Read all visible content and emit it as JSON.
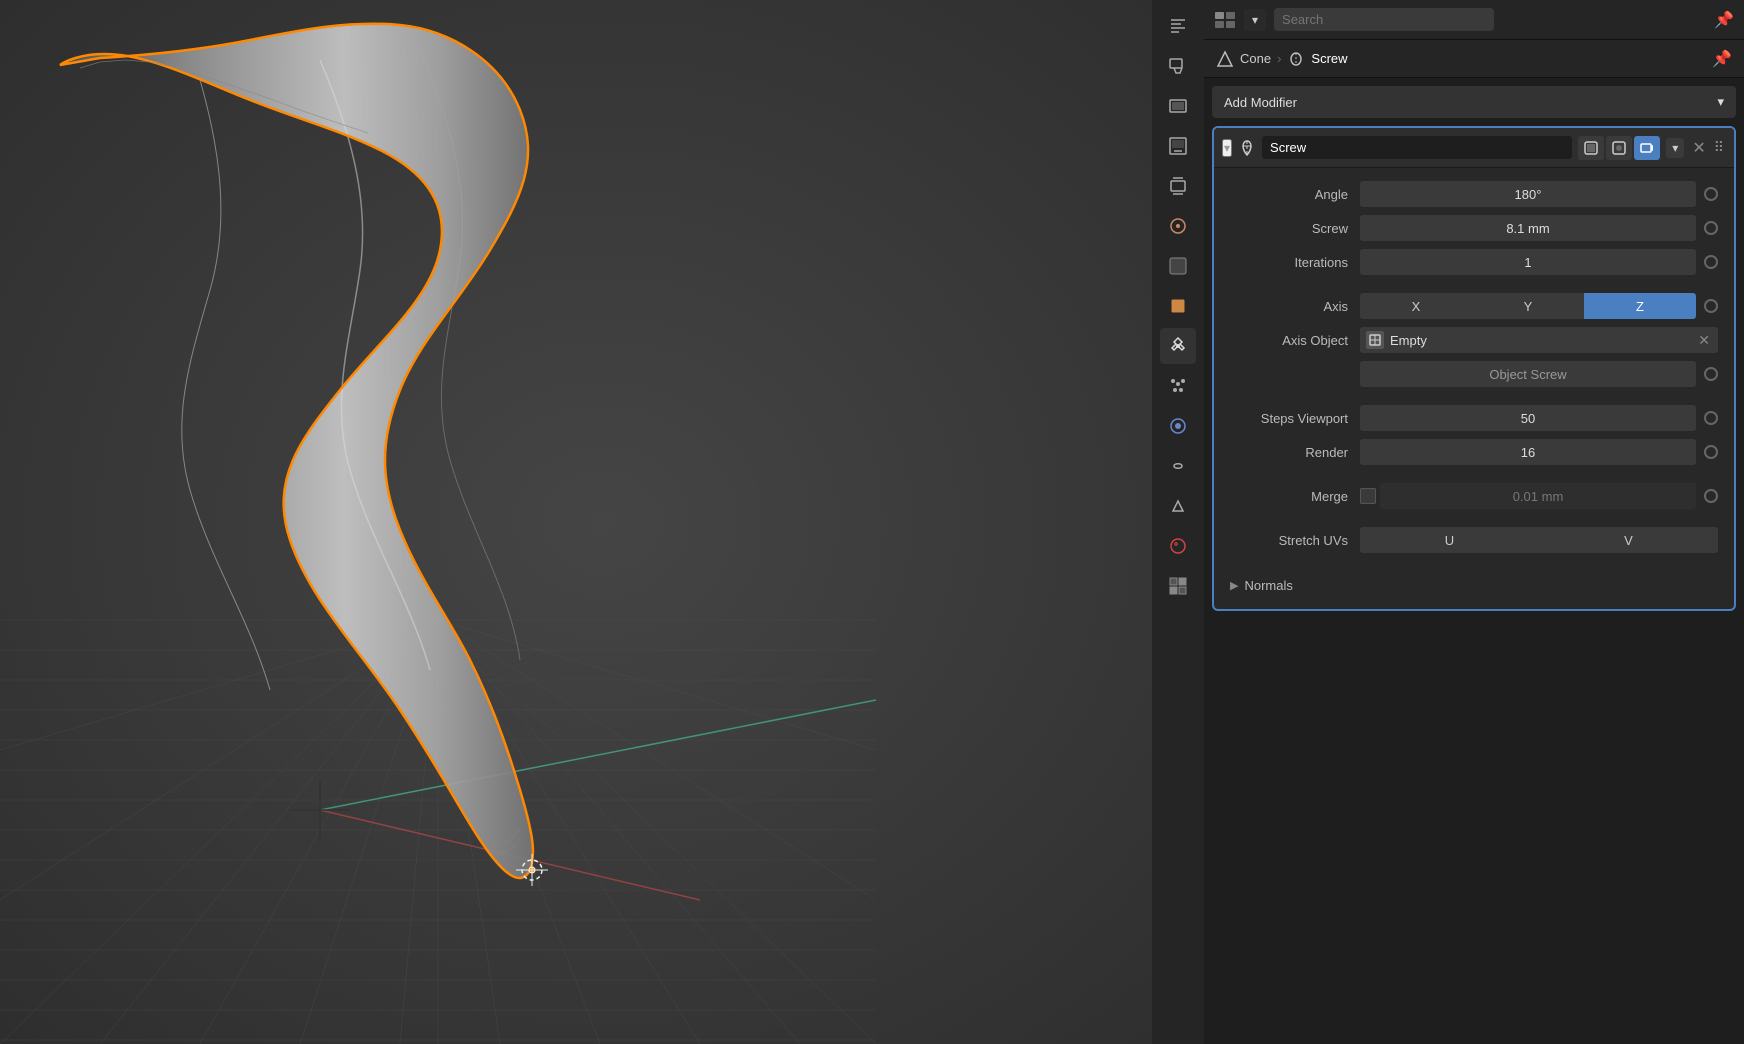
{
  "viewport": {
    "background_color": "#3a3a3a"
  },
  "topbar": {
    "search_placeholder": "Search",
    "dropdown_label": "▾"
  },
  "breadcrumb": {
    "parent": "Cone",
    "separator": "›",
    "current": "Screw"
  },
  "add_modifier": {
    "label": "Add Modifier",
    "dropdown_icon": "▾"
  },
  "modifier": {
    "name": "Screw",
    "props": {
      "angle_label": "Angle",
      "angle_value": "180°",
      "screw_label": "Screw",
      "screw_value": "8.1 mm",
      "iterations_label": "Iterations",
      "iterations_value": "1",
      "axis_label": "Axis",
      "axis_x": "X",
      "axis_y": "Y",
      "axis_z": "Z",
      "axis_object_label": "Axis Object",
      "axis_object_value": "Empty",
      "object_screw_label": "",
      "object_screw_placeholder": "Object Screw",
      "steps_viewport_label": "Steps Viewport",
      "steps_viewport_value": "50",
      "render_label": "Render",
      "render_value": "16",
      "merge_label": "Merge",
      "merge_value": "0.01 mm",
      "stretch_uvs_label": "Stretch UVs",
      "stretch_u": "U",
      "stretch_v": "V",
      "normals_label": "Normals"
    }
  },
  "sidebar_icons": [
    {
      "name": "tools-icon",
      "symbol": "🔧",
      "label": "Tools"
    },
    {
      "name": "scene-icon",
      "symbol": "📷",
      "label": "Scene"
    },
    {
      "name": "render-icon",
      "symbol": "📺",
      "label": "Render"
    },
    {
      "name": "output-icon",
      "symbol": "🖼",
      "label": "Output"
    },
    {
      "name": "view-layer-icon",
      "symbol": "📋",
      "label": "View Layer"
    },
    {
      "name": "scene-props-icon",
      "symbol": "🌐",
      "label": "Scene Properties"
    },
    {
      "name": "world-icon",
      "symbol": "⬛",
      "label": "World"
    },
    {
      "name": "object-props-icon",
      "symbol": "🟧",
      "label": "Object Properties"
    },
    {
      "name": "modifier-icon",
      "symbol": "🔩",
      "label": "Modifier Properties",
      "active": true
    },
    {
      "name": "particles-icon",
      "symbol": "✳",
      "label": "Particles"
    },
    {
      "name": "physics-icon",
      "symbol": "🔵",
      "label": "Physics"
    },
    {
      "name": "constraints-icon",
      "symbol": "🔗",
      "label": "Constraints"
    },
    {
      "name": "object-data-icon",
      "symbol": "▽",
      "label": "Object Data"
    },
    {
      "name": "material-icon",
      "symbol": "⬤",
      "label": "Material"
    },
    {
      "name": "texture-icon",
      "symbol": "🔲",
      "label": "Texture"
    }
  ]
}
